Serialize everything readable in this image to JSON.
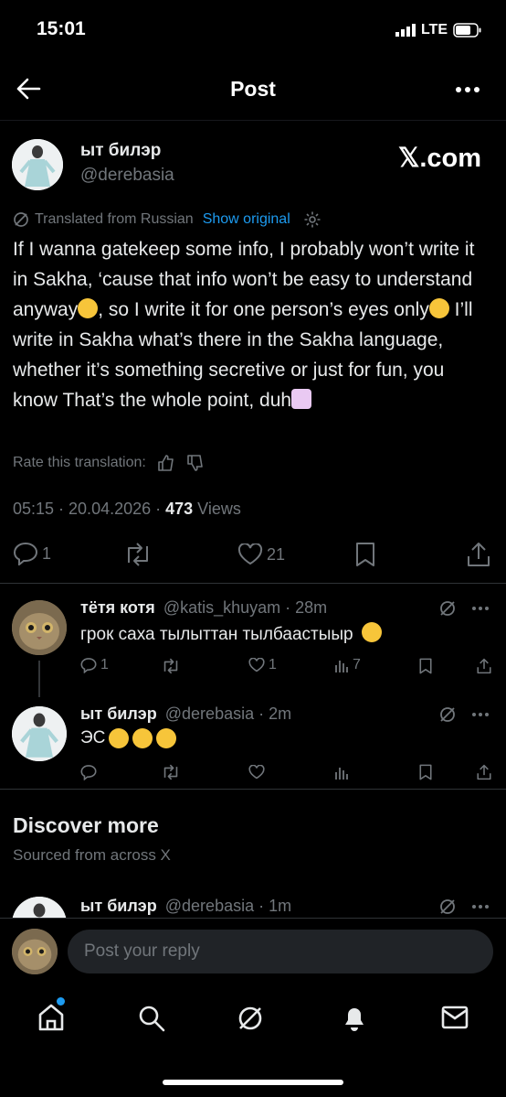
{
  "status_bar": {
    "time": "15:01",
    "network": "LTE"
  },
  "header": {
    "title": "Post"
  },
  "post": {
    "display_name": "ыт билэр",
    "handle": "@derebasia",
    "badge": "𝕏.com",
    "translated_label": "Translated from Russian",
    "show_original": "Show original",
    "text_parts": [
      "If I wanna gatekeep some info, I probably won’t write it in Sakha, ‘cause that info won’t be easy to understand anyway",
      ", so I write it for one person’s eyes only",
      " I’ll write in Sakha what’s there in the Sakha language, whether it’s something secretive or just for fun, you know That’s the whole point, duh"
    ],
    "rate_label": "Rate this translation:",
    "timestamp": "05:15 · 20.04.2026 · ",
    "views_count": "473",
    "views_label": " Views",
    "replies": "1",
    "likes": "21"
  },
  "replies": [
    {
      "display_name": "тётя котя",
      "handle": "@katis_khuyam · 28m",
      "text": "грок саха тылыттан тылбаастыыр",
      "replies": "1",
      "likes": "1",
      "views": "7"
    },
    {
      "display_name": "ыт билэр",
      "handle": "@derebasia · 2m",
      "text": "ЭС"
    }
  ],
  "discover": {
    "title": "Discover more",
    "subtitle": "Sourced from across X",
    "preview_name": "ыт билэр",
    "preview_handle": "@derebasia · 1m"
  },
  "composer": {
    "placeholder": "Post your reply"
  },
  "colors": {
    "accent": "#1d9bf0",
    "muted": "#71767b",
    "background": "#000000"
  }
}
